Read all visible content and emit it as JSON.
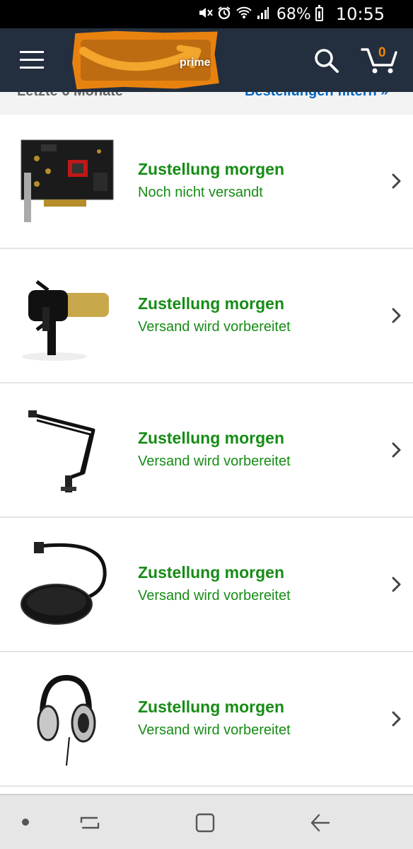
{
  "status_bar": {
    "battery_percent": "68%",
    "time": "10:55",
    "icons": [
      "mute-icon",
      "alarm-icon",
      "wifi-icon",
      "signal-icon",
      "battery-icon"
    ]
  },
  "header": {
    "brand": "prime",
    "cart_count": "0",
    "colors": {
      "background": "#232f3e",
      "logo": "#e8820f",
      "cart_count": "#f08804"
    }
  },
  "filter": {
    "period_label": "Letzte 6 Monate",
    "filter_link": "Bestellungen filtern »"
  },
  "orders": [
    {
      "product": "sound-card",
      "title": "Zustellung morgen",
      "status": "Noch nicht versandt"
    },
    {
      "product": "microphone",
      "title": "Zustellung morgen",
      "status": "Versand wird vorbereitet"
    },
    {
      "product": "microphone-arm",
      "title": "Zustellung morgen",
      "status": "Versand wird vorbereitet"
    },
    {
      "product": "pop-filter",
      "title": "Zustellung morgen",
      "status": "Versand wird vorbereitet"
    },
    {
      "product": "headphones",
      "title": "Zustellung morgen",
      "status": "Versand wird vorbereitet"
    }
  ],
  "colors": {
    "status_green": "#168c16",
    "link_blue": "#0066c0"
  },
  "nav_bar": {
    "icons": [
      "recents-icon",
      "home-icon",
      "back-icon"
    ]
  }
}
